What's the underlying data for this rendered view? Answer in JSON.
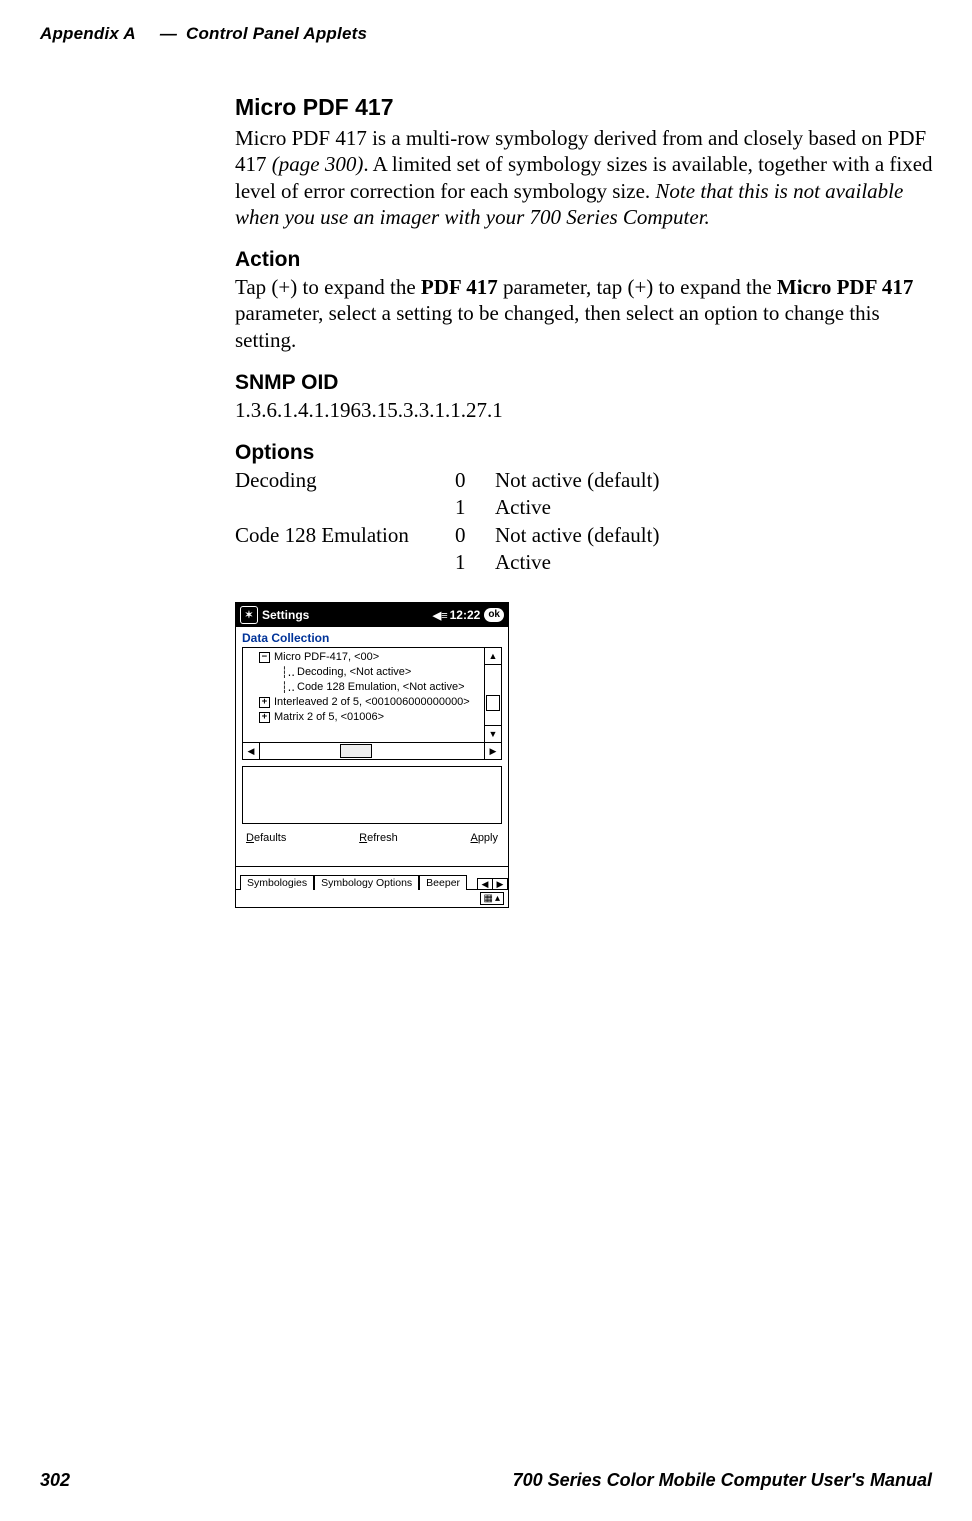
{
  "header": {
    "appendix": "Appendix  A",
    "dash": "—",
    "title": "Control Panel Applets"
  },
  "section": {
    "title": "Micro PDF 417",
    "intro_part1": "Micro PDF 417 is a multi-row symbology derived from and closely based on PDF 417 ",
    "intro_ref": "(page 300)",
    "intro_part2": ". A limited set of symbology sizes is available, together with a fixed level of error correction for each symbology size. ",
    "intro_note": "Note that this is not available when you use an imager with your 700 Series Computer."
  },
  "action": {
    "heading": "Action",
    "p1a": "Tap (+) to expand the ",
    "p1b": "PDF 417",
    "p1c": " parameter, tap (+) to expand the ",
    "p1d": "Micro PDF 417",
    "p1e": " parameter, select a setting to be changed, then select an option to change this setting."
  },
  "snmp": {
    "heading": "SNMP OID",
    "value": "1.3.6.1.4.1.1963.15.3.3.1.1.27.1"
  },
  "options": {
    "heading": "Options",
    "rows": [
      {
        "name": "Decoding",
        "code": "0",
        "desc": "Not active ",
        "note": "(default)"
      },
      {
        "name": "",
        "code": "1",
        "desc": "Active",
        "note": ""
      },
      {
        "name": "Code 128 Emulation",
        "code": "0",
        "desc": "Not active ",
        "note": "(default)"
      },
      {
        "name": "",
        "code": "1",
        "desc": "Active",
        "note": ""
      }
    ]
  },
  "device": {
    "titlebar": {
      "title": "Settings",
      "time": "12:22",
      "ok": "ok"
    },
    "applet_title": "Data Collection",
    "tree": {
      "rows": [
        {
          "expander": "−",
          "indent": 1,
          "label": "Micro PDF-417, <00>"
        },
        {
          "expander": "",
          "indent": 2,
          "label": "Decoding, <Not active>"
        },
        {
          "expander": "",
          "indent": 2,
          "label": "Code 128 Emulation, <Not active>"
        },
        {
          "expander": "+",
          "indent": 1,
          "label": "Interleaved 2 of 5, <001006000000000>"
        },
        {
          "expander": "+",
          "indent": 1,
          "label": "Matrix 2 of 5, <01006>"
        }
      ]
    },
    "buttons": {
      "defaults": "Defaults",
      "refresh": "Refresh",
      "apply": "Apply"
    },
    "tabs": {
      "t1": "Symbologies",
      "t2": "Symbology Options",
      "t3": "Beeper"
    },
    "sip": "▦"
  },
  "footer": {
    "page": "302",
    "book": "700 Series Color Mobile Computer User's Manual"
  }
}
